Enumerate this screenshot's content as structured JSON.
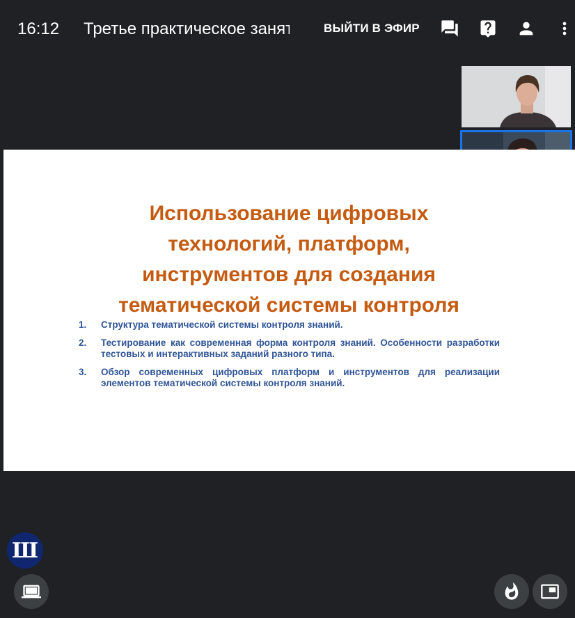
{
  "header": {
    "time": "16:12",
    "meeting_title": "Третье практическое занятие",
    "go_live_label": "ВЫЙТИ В ЭФИР",
    "icons": [
      "chat-icon",
      "help-icon",
      "person-icon",
      "more-vert-icon"
    ]
  },
  "participants": [
    {
      "tile": "participant-video-1",
      "active": false
    },
    {
      "tile": "participant-video-2",
      "active": true
    },
    {
      "tile": "participant-video-3",
      "active": false
    }
  ],
  "slide": {
    "title_lines": [
      "Использование цифровых",
      "технологий, платформ,",
      "инструментов для создания",
      "тематической системы контроля"
    ],
    "items": [
      {
        "num": "1.",
        "text": "Структура тематической системы контроля знаний."
      },
      {
        "num": "2.",
        "text": "Тестирование как современная форма контроля знаний. Особенности разработки тестовых и интерактивных заданий разного типа."
      },
      {
        "num": "3.",
        "text": "Обзор современных цифровых платформ и инструментов для реализации элементов тематической системы контроля знаний."
      }
    ],
    "title_color": "#c55a11",
    "text_color": "#2f5597"
  },
  "footer": {
    "logo_letter": "Ш",
    "left_button_icon": "present-screen-icon",
    "right_icons": [
      "fire-icon",
      "picture-in-picture-icon"
    ]
  },
  "colors": {
    "background": "#202124",
    "active_tile_border": "#1a73e8",
    "logo_bg": "#102770"
  }
}
